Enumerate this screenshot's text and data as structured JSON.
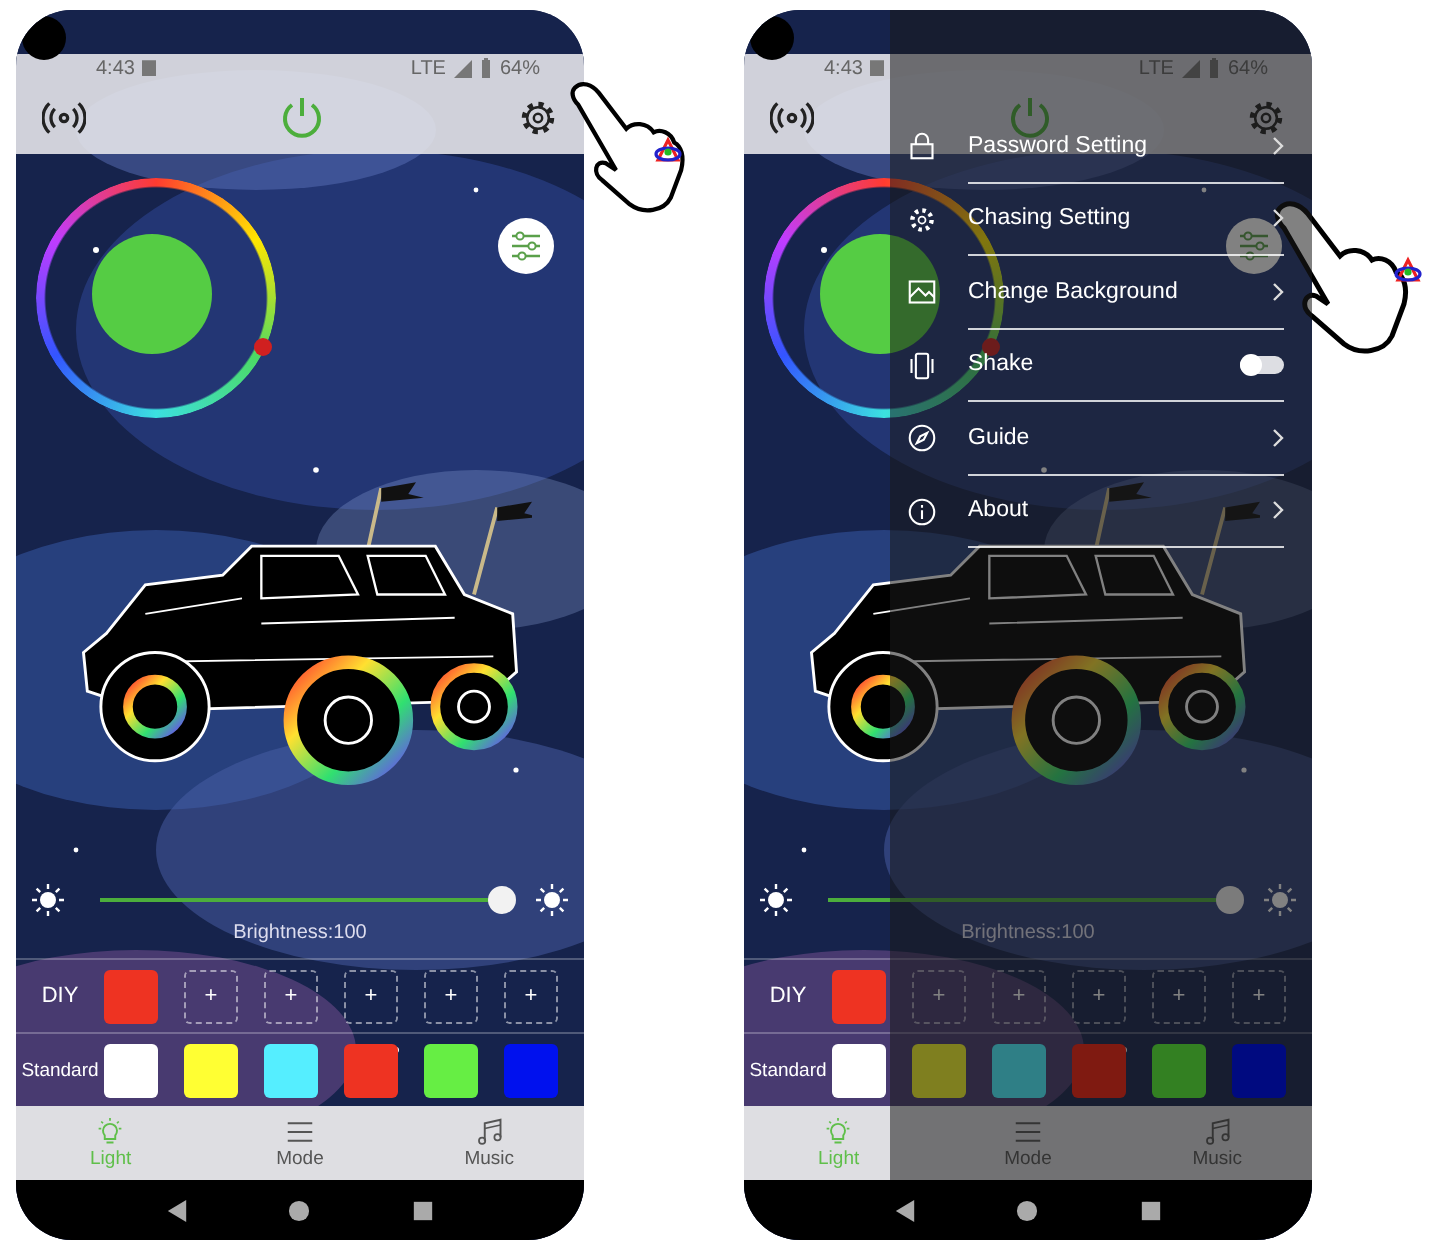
{
  "phones": [
    {
      "status_bar": {
        "time": "4:43",
        "network": "LTE",
        "battery": "64%"
      },
      "power_on": true,
      "color_wheel": {
        "color": "#55cc44"
      },
      "brightness": {
        "level": 1,
        "label": "Brightness:100"
      },
      "diy": {
        "label": "DIY",
        "slots": [
          {
            "kind": "color",
            "color": "#ee3322"
          },
          {
            "kind": "add",
            "label": "+"
          },
          {
            "kind": "add",
            "label": "+"
          },
          {
            "kind": "add",
            "label": "+"
          },
          {
            "kind": "add",
            "label": "+"
          },
          {
            "kind": "add",
            "label": "+"
          }
        ]
      },
      "standard": {
        "label": "Standard",
        "swatches": [
          {
            "color": "#ffffff"
          },
          {
            "color": "#ffff33"
          },
          {
            "color": "#55eeff"
          },
          {
            "color": "#ee3322"
          },
          {
            "color": "#66ee44"
          },
          {
            "color": "#0011ee"
          }
        ]
      },
      "nav": [
        {
          "label": "Light",
          "selected": true
        },
        {
          "label": "Mode",
          "selected": false
        },
        {
          "label": "Music",
          "selected": false
        }
      ]
    },
    {
      "status_bar": {
        "time": "4:43",
        "network": "LTE",
        "battery": "64%"
      },
      "power_on": true,
      "color_wheel": {
        "color": "#55cc44"
      },
      "brightness": {
        "level": 1,
        "label": "Brightness:100"
      },
      "diy": {
        "label": "DIY",
        "slots": [
          {
            "kind": "color",
            "color": "#ee3322"
          },
          {
            "kind": "add",
            "label": "+"
          },
          {
            "kind": "add",
            "label": "+"
          },
          {
            "kind": "add",
            "label": "+"
          },
          {
            "kind": "add",
            "label": "+"
          },
          {
            "kind": "add",
            "label": "+"
          }
        ]
      },
      "standard": {
        "label": "Standard",
        "swatches": [
          {
            "color": "#ffffff"
          },
          {
            "color": "#7f7f1f"
          },
          {
            "color": "#2f7f86"
          },
          {
            "color": "#7f1a11"
          },
          {
            "color": "#338022"
          },
          {
            "color": "#000a80"
          }
        ]
      },
      "nav": [
        {
          "label": "Light",
          "selected": true
        },
        {
          "label": "Mode",
          "selected": false
        },
        {
          "label": "Music",
          "selected": false
        }
      ],
      "menu": {
        "items": [
          {
            "kind": "link",
            "label": "Password Setting"
          },
          {
            "kind": "link",
            "label": "Chasing Setting"
          },
          {
            "kind": "link",
            "label": "Change Background"
          },
          {
            "kind": "toggle",
            "label": "Shake",
            "on": false
          },
          {
            "kind": "link",
            "label": "Guide"
          },
          {
            "kind": "link",
            "label": "About"
          }
        ]
      }
    }
  ]
}
